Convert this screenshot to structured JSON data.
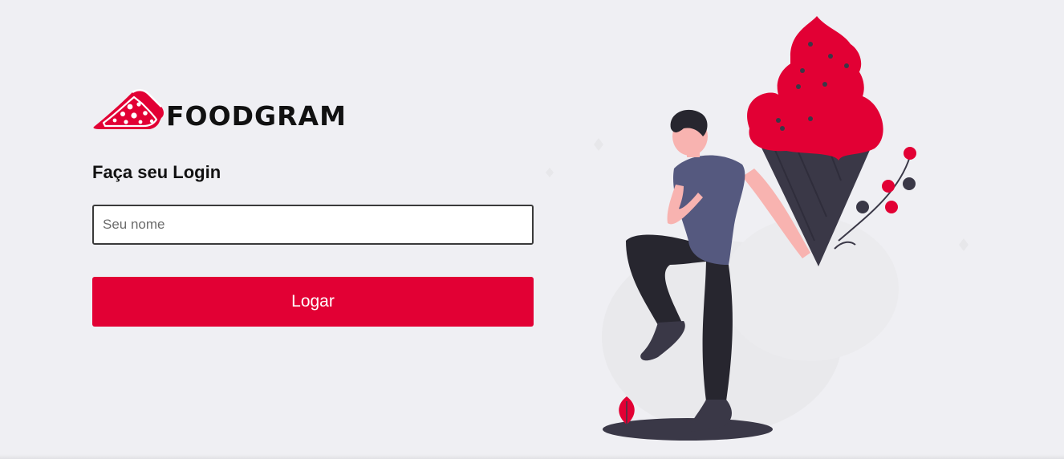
{
  "brand": {
    "name": "FOODGRAM",
    "accent_color": "#e20034",
    "logo_icon": "pizza-slice-icon"
  },
  "login": {
    "title": "Faça seu Login",
    "name_input": {
      "placeholder": "Seu nome",
      "value": ""
    },
    "submit_label": "Logar"
  },
  "illustration": {
    "icon": "man-with-ice-cream-illustration"
  }
}
